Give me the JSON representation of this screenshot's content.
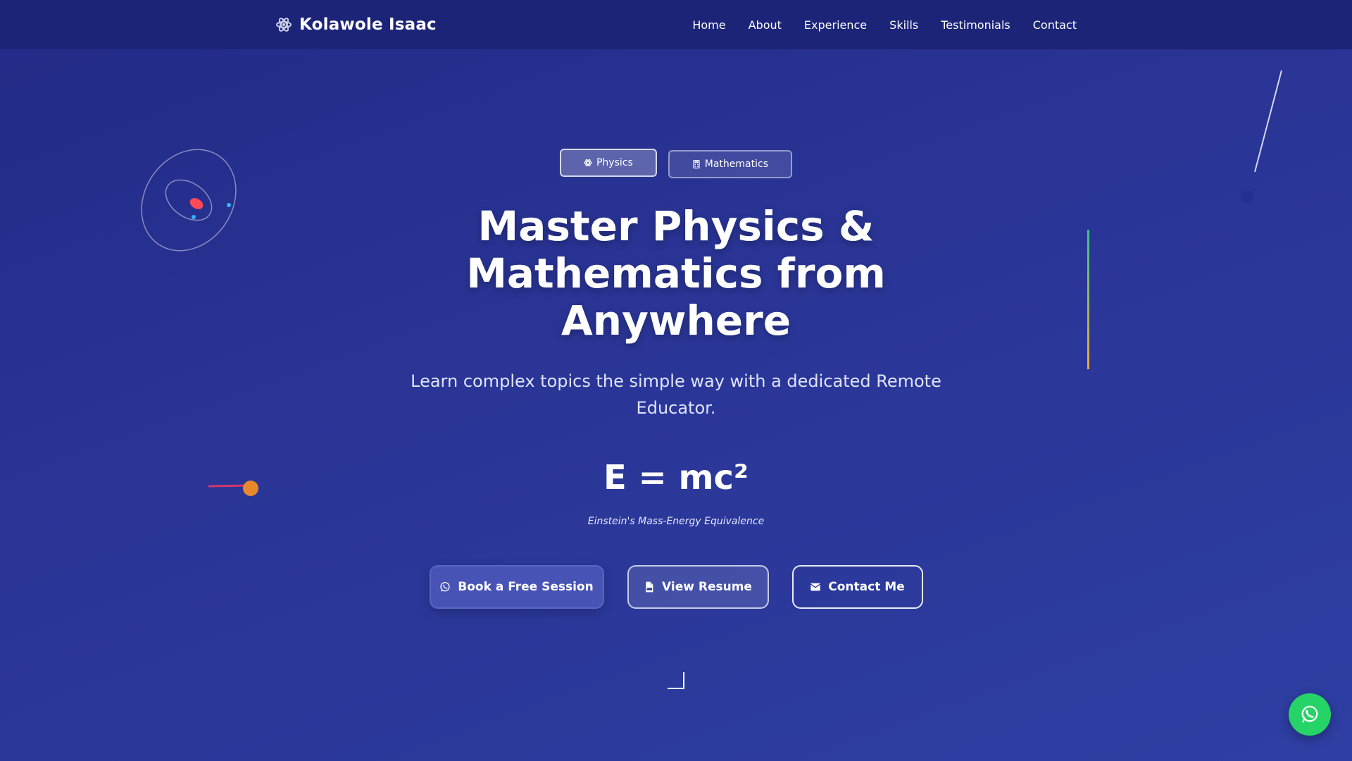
{
  "brand": {
    "name": "Kolawole Isaac",
    "icon": "atom-icon"
  },
  "nav": {
    "items": [
      {
        "label": "Home"
      },
      {
        "label": "About"
      },
      {
        "label": "Experience"
      },
      {
        "label": "Skills"
      },
      {
        "label": "Testimonials"
      },
      {
        "label": "Contact"
      }
    ]
  },
  "hero": {
    "subjects": [
      {
        "label": "Physics",
        "icon": "atom-icon",
        "active": true
      },
      {
        "label": "Mathematics",
        "icon": "calculator-icon",
        "active": false
      }
    ],
    "headline": "Master Physics & Mathematics from Anywhere",
    "subtitle": "Learn complex topics the simple way with a dedicated Remote Educator.",
    "formula": "E = mc²",
    "formula_caption": "Einstein's Mass-Energy Equivalence",
    "buttons": {
      "book": {
        "label": "Book a Free Session",
        "icon": "whatsapp-icon"
      },
      "resume": {
        "label": "View Resume",
        "icon": "pdf-file-icon"
      },
      "contact": {
        "label": "Contact Me",
        "icon": "envelope-icon"
      }
    }
  },
  "floating": {
    "whatsapp_icon": "whatsapp-icon"
  },
  "colors": {
    "nav_bg": "#1c2478",
    "hero_bg_start": "#232a86",
    "hero_bg_end": "#2e3ea2",
    "primary_button": "#4753b5",
    "whatsapp_green": "#25d366",
    "nucleus_red": "#ff4a57",
    "electron_blue": "#2fb6ff",
    "ball_orange": "#e8882b"
  }
}
